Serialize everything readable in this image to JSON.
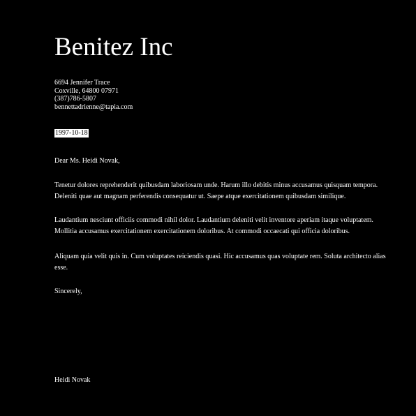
{
  "sender": {
    "company": "Benitez Inc",
    "address_line1": "6694 Jennifer Trace",
    "address_line2": "Coxville, 64800 07971",
    "phone": "(387)786-5807",
    "email": "bennettadrienne@tapia.com"
  },
  "date": "1997-10-18",
  "salutation": "Dear Ms. Heidi Novak,",
  "paragraphs": [
    "Tenetur dolores reprehenderit quibusdam laboriosam unde. Harum illo debitis minus accusamus quisquam tempora. Deleniti quae aut magnam perferendis consequatur ut. Saepe atque exercitationem quibusdam similique.",
    "Laudantium nesciunt officiis commodi nihil dolor. Laudantium deleniti velit inventore aperiam itaque voluptatem. Mollitia accusamus exercitationem exercitationem doloribus. At commodi occaecati qui officia doloribus.",
    "Aliquam quia velit quis in. Cum voluptates reiciendis quasi. Hic accusamus quas voluptate rem. Soluta architecto alias esse."
  ],
  "closing": "Sincerely,",
  "signature": "Heidi Novak"
}
